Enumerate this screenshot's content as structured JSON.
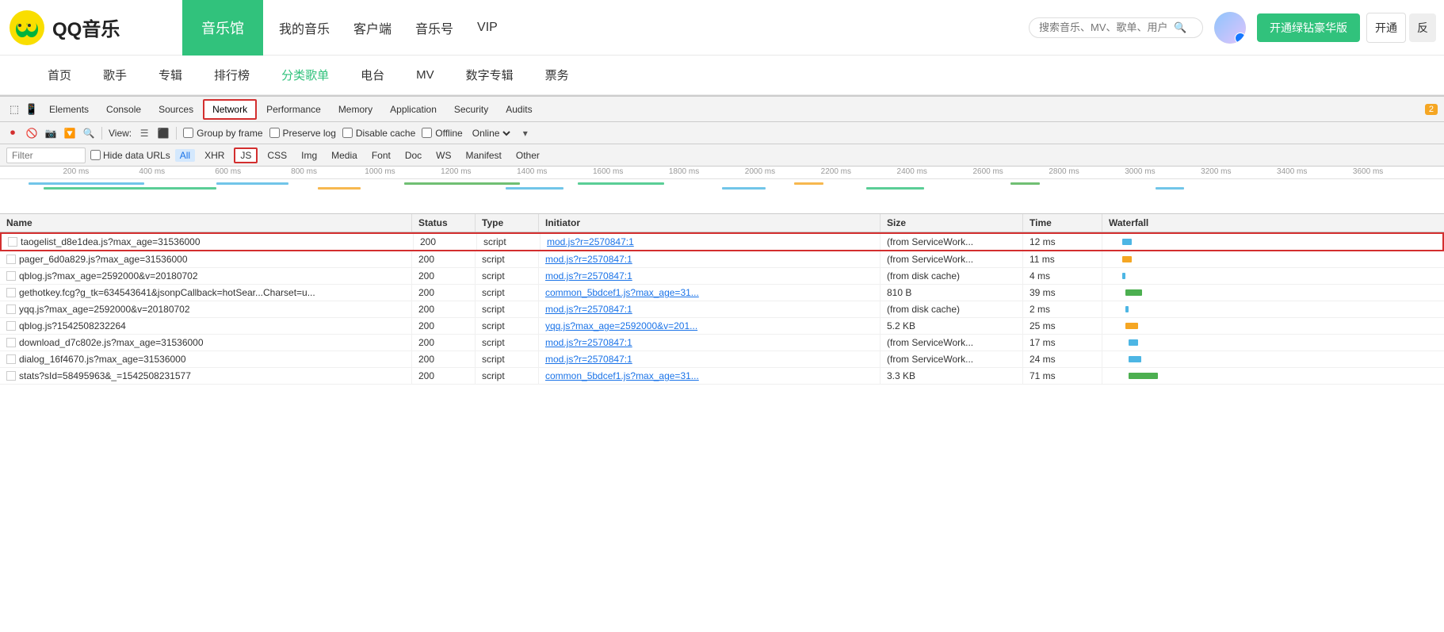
{
  "app": {
    "logo_text": "QQ音乐",
    "nav_active": "音乐馆",
    "nav_links": [
      "我的音乐",
      "客户端",
      "音乐号",
      "VIP"
    ],
    "search_placeholder": "搜索音乐、MV、歌单、用户",
    "vip_btn": "开通绿钻豪华版",
    "open_btn": "开通",
    "feedback_btn": "反"
  },
  "secondary_nav": {
    "items": [
      "首页",
      "歌手",
      "专辑",
      "排行榜",
      "分类歌单",
      "电台",
      "MV",
      "数字专辑",
      "票务"
    ],
    "active": "分类歌单"
  },
  "devtools": {
    "tabs": [
      {
        "label": "Elements",
        "active": false
      },
      {
        "label": "Console",
        "active": false
      },
      {
        "label": "Sources",
        "active": false
      },
      {
        "label": "Network",
        "active": true
      },
      {
        "label": "Performance",
        "active": false
      },
      {
        "label": "Memory",
        "active": false
      },
      {
        "label": "Application",
        "active": false
      },
      {
        "label": "Security",
        "active": false
      },
      {
        "label": "Audits",
        "active": false
      }
    ],
    "warning_count": "2",
    "toolbar": {
      "view_label": "View:",
      "group_by_frame": "Group by frame",
      "preserve_log": "Preserve log",
      "disable_cache": "Disable cache",
      "offline": "Offline",
      "online": "Online"
    },
    "filter": {
      "placeholder": "Filter",
      "hide_data_urls": "Hide data URLs",
      "buttons": [
        "All",
        "XHR",
        "JS",
        "CSS",
        "Img",
        "Media",
        "Font",
        "Doc",
        "WS",
        "Manifest",
        "Other"
      ],
      "active_btn": "JS"
    },
    "timeline": {
      "ruler_marks": [
        "200 ms",
        "400 ms",
        "600 ms",
        "800 ms",
        "1000 ms",
        "1200 ms",
        "1400 ms",
        "1600 ms",
        "1800 ms",
        "2000 ms",
        "2200 ms",
        "2400 ms",
        "2600 ms",
        "2800 ms",
        "3000 ms",
        "3200 ms",
        "3400 ms",
        "3600 ms"
      ]
    },
    "table": {
      "headers": [
        "Name",
        "Status",
        "Type",
        "Initiator",
        "Size",
        "Time",
        "Waterfall"
      ],
      "rows": [
        {
          "name": "taogelist_d8e1dea.js?max_age=31536000",
          "status": "200",
          "type": "script",
          "initiator": "mod.js?r=2570847:1",
          "size": "(from ServiceWork...",
          "time": "12 ms",
          "waterfall_left": "4%",
          "waterfall_width": "3%",
          "waterfall_color": "#4db6e4",
          "highlighted": true
        },
        {
          "name": "pager_6d0a829.js?max_age=31536000",
          "status": "200",
          "type": "script",
          "initiator": "mod.js?r=2570847:1",
          "size": "(from ServiceWork...",
          "time": "11 ms",
          "waterfall_left": "4%",
          "waterfall_width": "3%",
          "waterfall_color": "#f5a623"
        },
        {
          "name": "qblog.js?max_age=2592000&v=20180702",
          "status": "200",
          "type": "script",
          "initiator": "mod.js?r=2570847:1",
          "size": "(from disk cache)",
          "time": "4 ms",
          "waterfall_left": "4%",
          "waterfall_width": "1%",
          "waterfall_color": "#4db6e4"
        },
        {
          "name": "gethotkey.fcg?g_tk=634543641&jsonpCallback=hotSear...Charset=u...",
          "status": "200",
          "type": "script",
          "initiator": "common_5bdcef1.js?max_age=31...",
          "size": "810 B",
          "time": "39 ms",
          "waterfall_left": "5%",
          "waterfall_width": "5%",
          "waterfall_color": "#4caf50"
        },
        {
          "name": "yqq.js?max_age=2592000&v=20180702",
          "status": "200",
          "type": "script",
          "initiator": "mod.js?r=2570847:1",
          "size": "(from disk cache)",
          "time": "2 ms",
          "waterfall_left": "5%",
          "waterfall_width": "1%",
          "waterfall_color": "#4db6e4"
        },
        {
          "name": "qblog.js?1542508232264",
          "status": "200",
          "type": "script",
          "initiator": "yqq.js?max_age=2592000&v=201...",
          "size": "5.2 KB",
          "time": "25 ms",
          "waterfall_left": "5%",
          "waterfall_width": "4%",
          "waterfall_color": "#f5a623"
        },
        {
          "name": "download_d7c802e.js?max_age=31536000",
          "status": "200",
          "type": "script",
          "initiator": "mod.js?r=2570847:1",
          "size": "(from ServiceWork...",
          "time": "17 ms",
          "waterfall_left": "6%",
          "waterfall_width": "3%",
          "waterfall_color": "#4db6e4"
        },
        {
          "name": "dialog_16f4670.js?max_age=31536000",
          "status": "200",
          "type": "script",
          "initiator": "mod.js?r=2570847:1",
          "size": "(from ServiceWork...",
          "time": "24 ms",
          "waterfall_left": "6%",
          "waterfall_width": "4%",
          "waterfall_color": "#4db6e4"
        },
        {
          "name": "stats?sId=58495963&_=1542508231577",
          "status": "200",
          "type": "script",
          "initiator": "common_5bdcef1.js?max_age=31...",
          "size": "3.3 KB",
          "time": "71 ms",
          "waterfall_left": "6%",
          "waterfall_width": "9%",
          "waterfall_color": "#4caf50"
        }
      ]
    }
  }
}
